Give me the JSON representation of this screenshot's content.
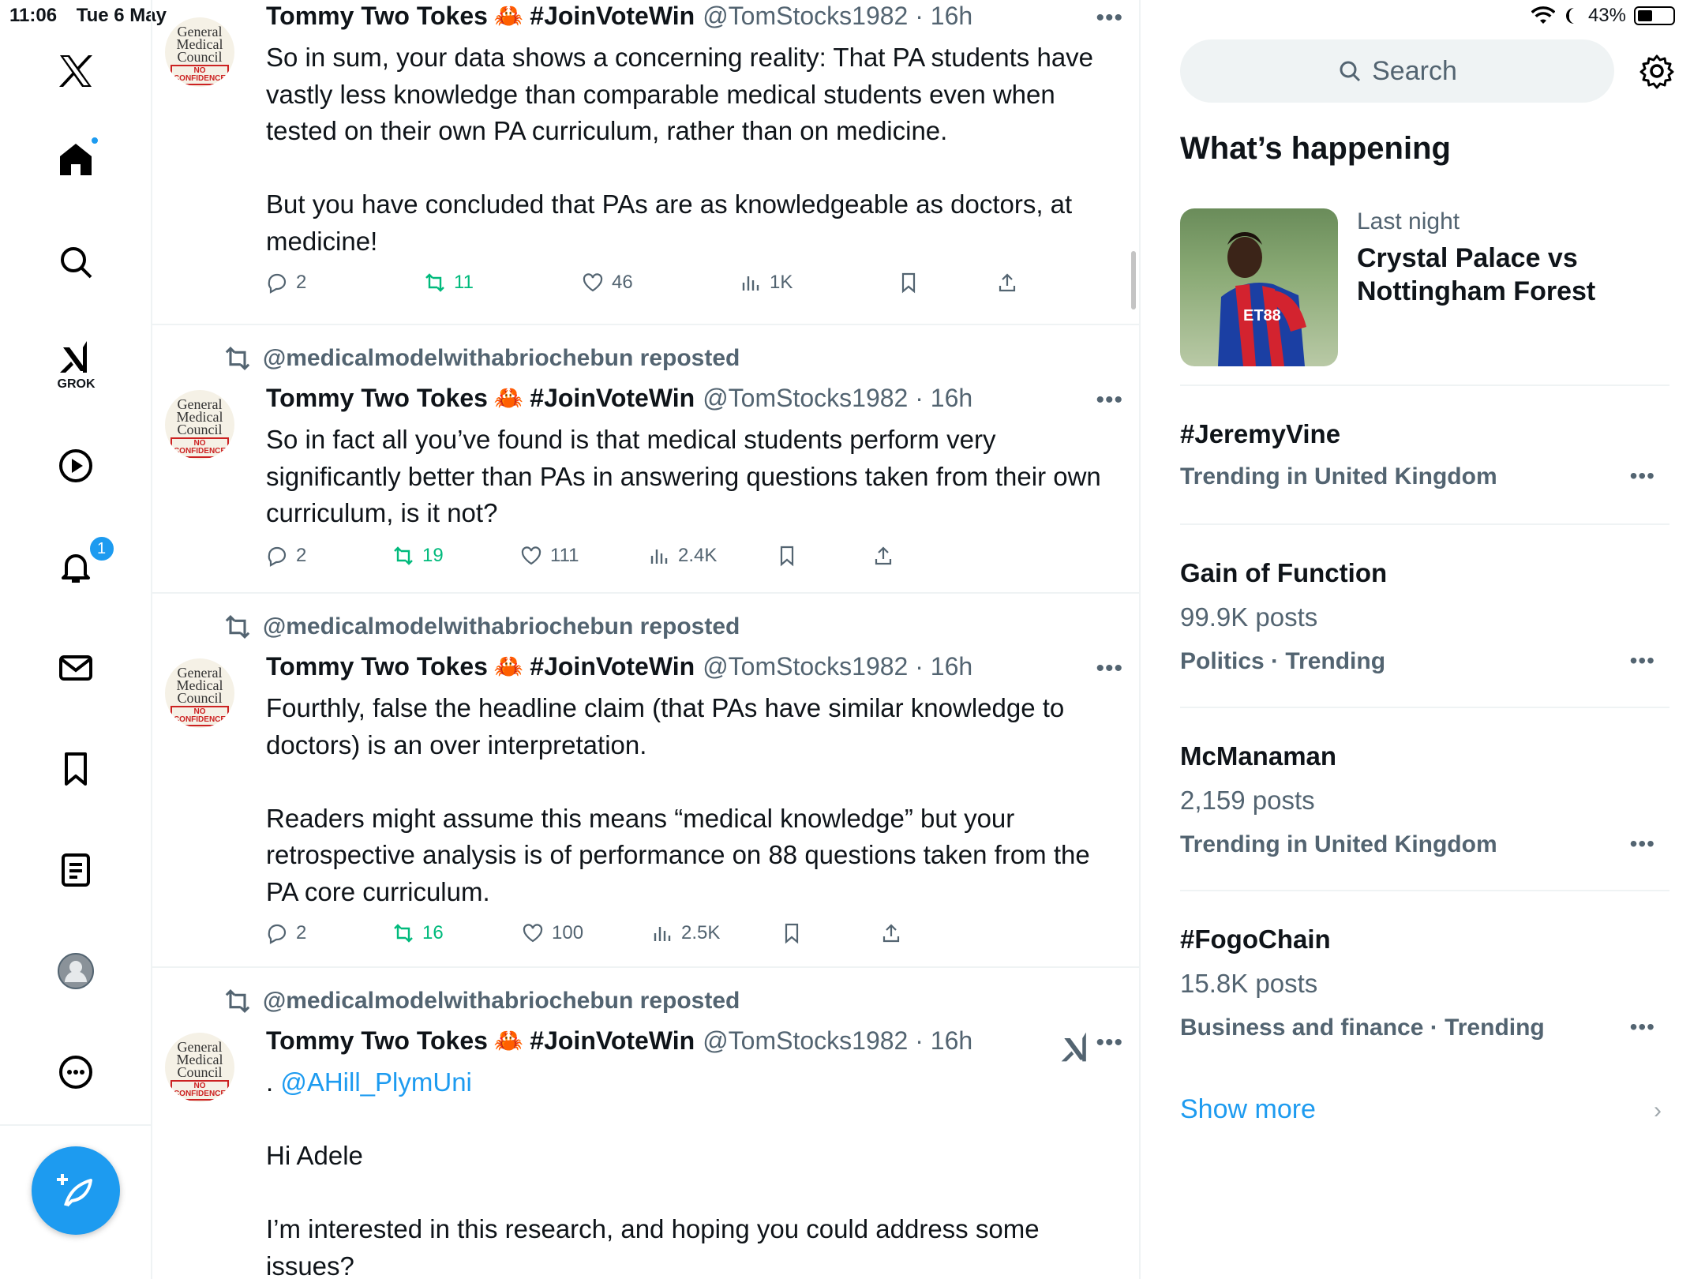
{
  "status": {
    "time": "11:06",
    "date": "Tue 6 May",
    "battery": "43%",
    "battery_level": 0.43
  },
  "sidebar": {
    "grok_label": "GROK",
    "notifications_badge": "1",
    "items": [
      "x-logo",
      "home-icon",
      "search-icon",
      "grok-icon",
      "video-icon",
      "bell-icon",
      "mail-icon",
      "bookmark-icon",
      "lists-icon",
      "profile-icon",
      "more-icon"
    ]
  },
  "feed": {
    "tweets": [
      {
        "reposted_by": "",
        "name": "Tommy Two Tokes",
        "emoji": "🦀",
        "tag": "#JoinVoteWin",
        "handle": "@TomStocks1982 · 16h",
        "body": "So in sum, your data shows a concerning reality: That PA students have vastly less knowledge than comparable medical students even when tested on their own PA curriculum, rather than on medicine.\n\nBut you have concluded that PAs are as knowledgeable as doctors, at medicine!",
        "replies": "2",
        "reposts": "11",
        "likes": "46",
        "views": "1K",
        "avatar": {
          "l1": "General",
          "l2": "Medical",
          "l3": "Council",
          "badge1": "NO",
          "badge2": "CONFIDENCE"
        }
      },
      {
        "reposted_by": "@medicalmodelwithabriochebun reposted",
        "name": "Tommy Two Tokes",
        "emoji": "🦀",
        "tag": "#JoinVoteWin",
        "handle": "@TomStocks1982 · 16h",
        "body": "So in fact all you’ve found is that medical students perform very significantly better than PAs in answering questions taken from their own curriculum, is it not?",
        "replies": "2",
        "reposts": "19",
        "likes": "111",
        "views": "2.4K"
      },
      {
        "reposted_by": "@medicalmodelwithabriochebun reposted",
        "name": "Tommy Two Tokes",
        "emoji": "🦀",
        "tag": "#JoinVoteWin",
        "handle": "@TomStocks1982 · 16h",
        "body": "Fourthly, false the headline claim  (that PAs have similar knowledge to doctors) is an over interpretation.\n\nReaders might assume this means “medical knowledge” but your retrospective analysis is of performance on 88 questions taken from the PA core curriculum.",
        "replies": "2",
        "reposts": "16",
        "likes": "100",
        "views": "2.5K"
      },
      {
        "reposted_by": "@medicalmodelwithabriochebun reposted",
        "name": "Tommy Two Tokes",
        "emoji": "🦀",
        "tag": "#JoinVoteWin",
        "handle": "@TomStocks1982 · 16h",
        "body_prefix": ". ",
        "mention": "@AHill_PlymUni",
        "body": "Hi Adele\n\nI’m interested in this research, and hoping you could address some issues?"
      }
    ]
  },
  "right": {
    "search_placeholder": "Search",
    "section_title": "What’s happening",
    "event": {
      "meta": "Last night",
      "title": "Crystal Palace vs Nottingham Forest",
      "shirt_text": "ET88"
    },
    "trends": [
      {
        "name": "#JeremyVine",
        "posts": "",
        "context": "Trending in United Kingdom"
      },
      {
        "name": "Gain of Function",
        "posts": "99.9K posts",
        "context": "Politics · Trending"
      },
      {
        "name": "McManaman",
        "posts": "2,159 posts",
        "context": "Trending in United Kingdom"
      },
      {
        "name": "#FogoChain",
        "posts": "15.8K posts",
        "context": "Business and finance · Trending"
      }
    ],
    "show_more": "Show more"
  },
  "colors": {
    "accent": "#1d9bf0",
    "repost_green": "#00ba7c",
    "secondary_text": "#536471",
    "divider": "#eff3f4"
  }
}
